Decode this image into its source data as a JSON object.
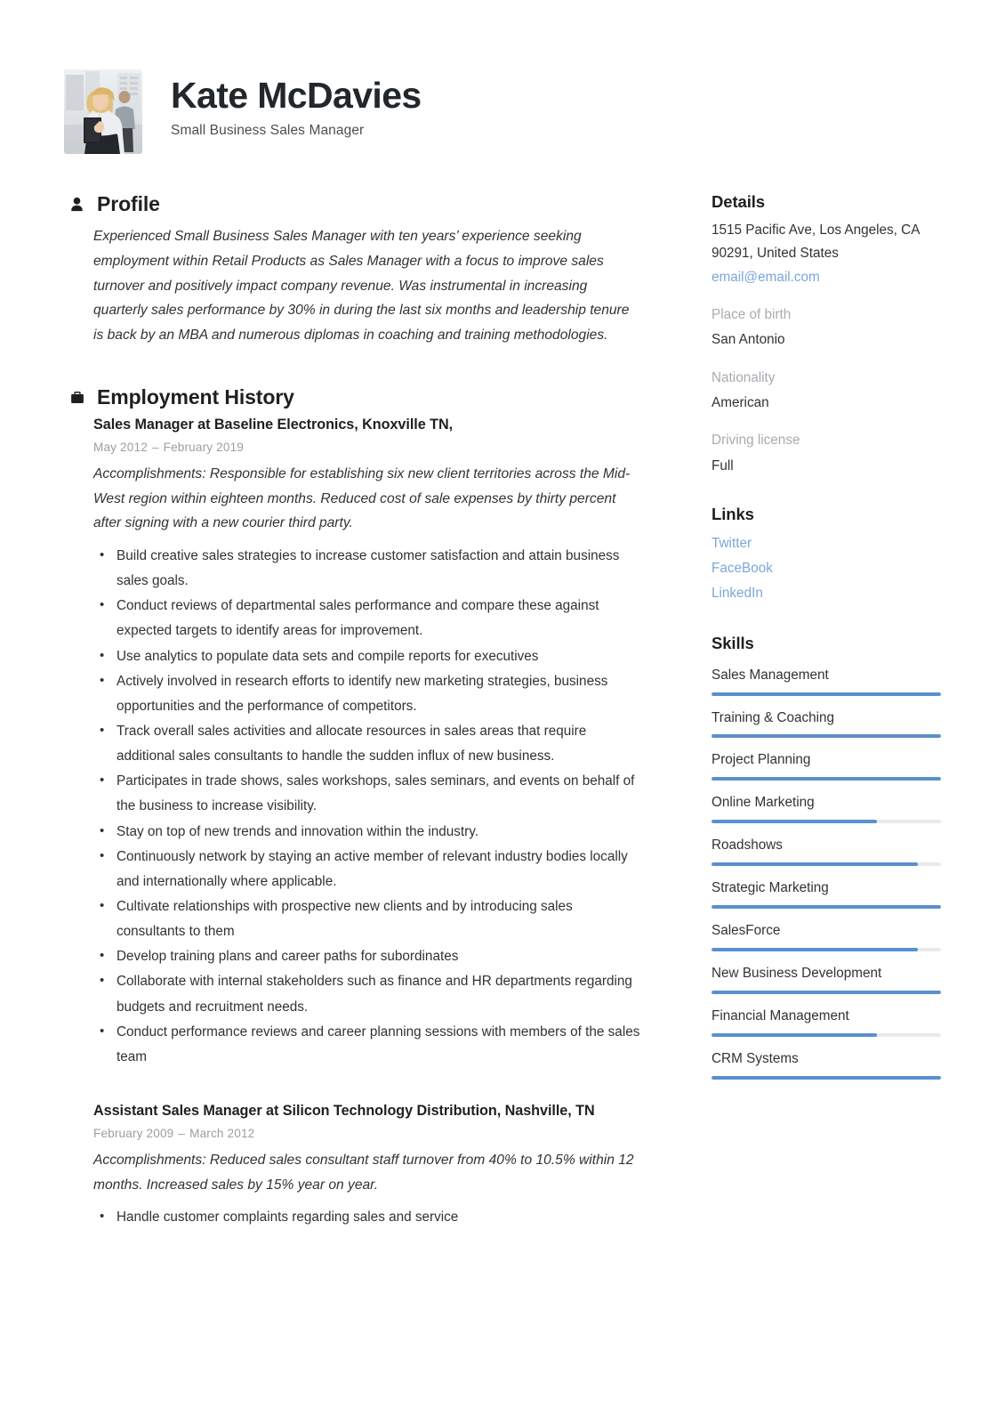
{
  "header": {
    "name": "Kate McDavies",
    "job_title": "Small Business Sales Manager",
    "photo_alt": "profile-photo"
  },
  "profile": {
    "section_title": "Profile",
    "icon": "person-icon",
    "text": "Experienced Small Business Sales Manager with ten years’ experience seeking employment within Retail Products as Sales Manager with a focus to improve sales turnover and positively impact company revenue. Was instrumental in increasing quarterly sales performance by 30% in during the last six months and leadership tenure is back by an MBA and numerous diplomas in coaching and training methodologies."
  },
  "employment": {
    "section_title": "Employment History",
    "icon": "briefcase-icon",
    "jobs": [
      {
        "title": "Sales Manager at Baseline Electronics, Knoxville TN,",
        "start": "May 2012",
        "dash": "–",
        "end": "February 2019",
        "accomplishments": "Accomplishments: Responsible for establishing six new client territories across the Mid-West region within eighteen months. Reduced cost of sale expenses by thirty percent after signing with a new courier third party.",
        "bullets": [
          "Build creative sales strategies to increase customer satisfaction and attain business sales goals.",
          "Conduct reviews of departmental sales performance and compare these against expected targets to identify areas for improvement.",
          "Use analytics to populate data sets and compile reports for executives",
          "Actively involved in research efforts to identify new marketing strategies, business opportunities and the performance of competitors.",
          "Track overall sales activities and allocate resources in sales areas that require additional sales consultants to handle the sudden influx of new business.",
          "Participates in trade shows, sales workshops, sales seminars, and events on behalf of the business to increase visibility.",
          "Stay on top of new trends and innovation within the industry.",
          "Continuously network by staying an active member of relevant industry bodies locally and internationally where applicable.",
          "Cultivate relationships with prospective new clients and  by introducing sales consultants to them",
          "Develop training plans and career paths for subordinates",
          "Collaborate with internal stakeholders such as finance and HR departments regarding budgets and recruitment needs.",
          "Conduct performance reviews and career planning sessions with members of the sales team"
        ]
      },
      {
        "title": "Assistant Sales Manager at Silicon Technology Distribution, Nashville, TN",
        "start": "February 2009",
        "dash": "–",
        "end": "March 2012",
        "accomplishments": "Accomplishments: Reduced sales consultant staff turnover from 40% to 10.5% within 12 months. Increased sales by 15% year on year.",
        "bullets": [
          "Handle customer complaints regarding sales and service"
        ]
      }
    ]
  },
  "details": {
    "section_title": "Details",
    "address_line1": "1515 Pacific Ave, Los Angeles, CA",
    "address_line2": "90291, United States",
    "email": "email@email.com",
    "fields": [
      {
        "label": "Place of birth",
        "value": "San Antonio"
      },
      {
        "label": "Nationality",
        "value": "American"
      },
      {
        "label": "Driving license",
        "value": "Full"
      }
    ]
  },
  "links": {
    "section_title": "Links",
    "items": [
      {
        "label": "Twitter"
      },
      {
        "label": "FaceBook"
      },
      {
        "label": "LinkedIn"
      }
    ]
  },
  "skills": {
    "section_title": "Skills",
    "items": [
      {
        "name": "Sales Management",
        "level": 100
      },
      {
        "name": "Training & Coaching",
        "level": 100
      },
      {
        "name": "Project Planning",
        "level": 100
      },
      {
        "name": "Online Marketing",
        "level": 72
      },
      {
        "name": "Roadshows",
        "level": 90
      },
      {
        "name": "Strategic Marketing",
        "level": 100
      },
      {
        "name": "SalesForce",
        "level": 90
      },
      {
        "name": "New Business Development",
        "level": 100
      },
      {
        "name": "Financial Management",
        "level": 72
      },
      {
        "name": "CRM Systems",
        "level": 100
      }
    ]
  },
  "colors": {
    "accent_blue": "#5a8fd0",
    "link_blue": "#7aa7d9",
    "text_dark": "#2f3337",
    "muted_gray": "#a7acb1",
    "track_gray": "#eaeaea"
  }
}
